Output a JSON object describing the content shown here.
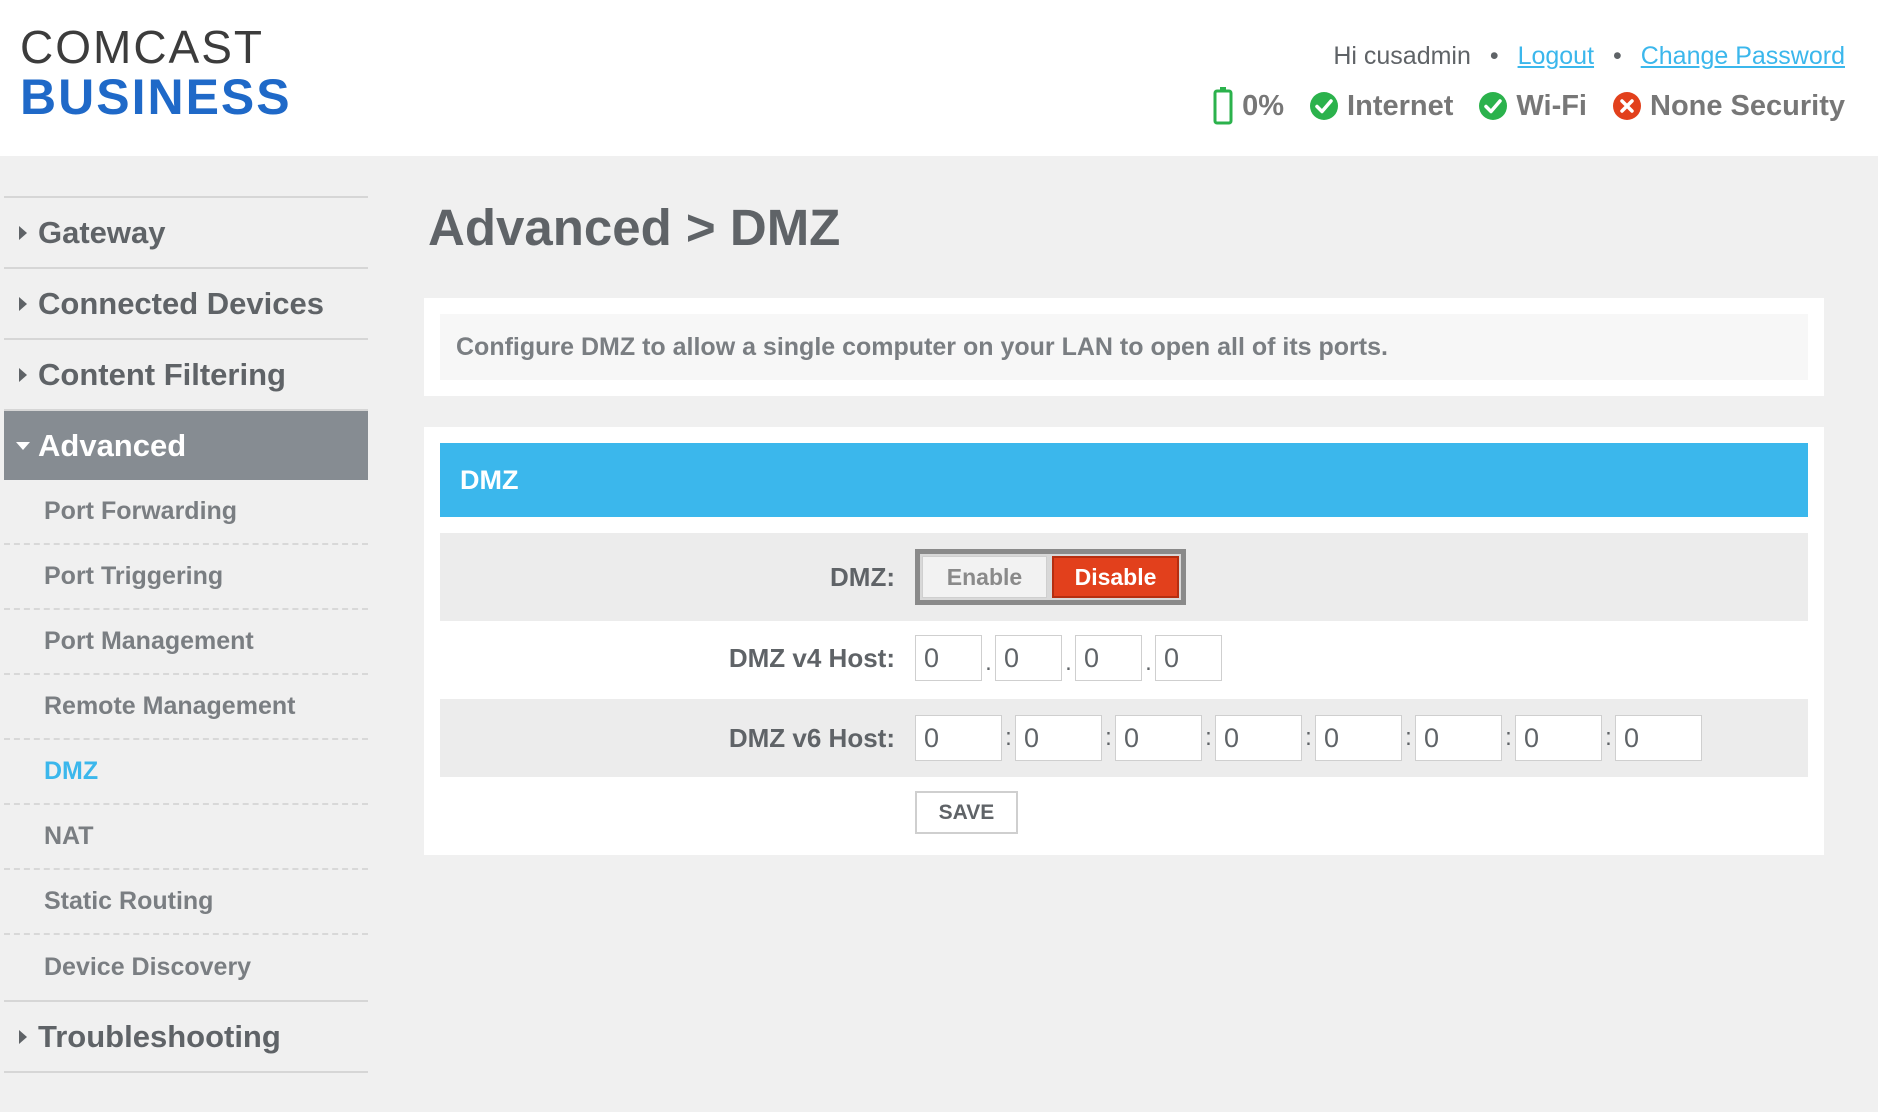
{
  "header": {
    "logo_line1": "COMCAST",
    "logo_line2": "BUSINESS",
    "greeting": "Hi cusadmin",
    "separator": "•",
    "logout": "Logout",
    "change_password": "Change Password",
    "status": [
      {
        "label": "0%",
        "icon": "battery-icon",
        "color": "#2bb24c"
      },
      {
        "label": "Internet",
        "icon": "check-circle-icon",
        "color": "#2bb24c"
      },
      {
        "label": "Wi-Fi",
        "icon": "check-circle-icon",
        "color": "#2bb24c"
      },
      {
        "label": "None Security",
        "icon": "x-circle-icon",
        "color": "#e2401c"
      }
    ]
  },
  "sidebar": {
    "items": [
      {
        "label": "Gateway"
      },
      {
        "label": "Connected Devices"
      },
      {
        "label": "Content Filtering"
      },
      {
        "label": "Advanced"
      },
      {
        "label": "Troubleshooting"
      }
    ],
    "advanced_sub": [
      {
        "label": "Port Forwarding"
      },
      {
        "label": "Port Triggering"
      },
      {
        "label": "Port Management"
      },
      {
        "label": "Remote Management"
      },
      {
        "label": "DMZ"
      },
      {
        "label": "NAT"
      },
      {
        "label": "Static Routing"
      },
      {
        "label": "Device Discovery"
      }
    ]
  },
  "main": {
    "title": "Advanced > DMZ",
    "description": "Configure DMZ to allow a single computer on your LAN to open all of its ports.",
    "panel_title": "DMZ",
    "dmz_label": "DMZ:",
    "enable_label": "Enable",
    "disable_label": "Disable",
    "v4_label": "DMZ v4 Host:",
    "v4_values": [
      "0",
      "0",
      "0",
      "0"
    ],
    "v4_sep": ".",
    "v6_label": "DMZ v6 Host:",
    "v6_values": [
      "0",
      "0",
      "0",
      "0",
      "0",
      "0",
      "0",
      "0"
    ],
    "v6_sep": ":",
    "save_label": "SAVE"
  },
  "colors": {
    "accent": "#3bb7ec",
    "disable_active": "#e2401c",
    "sidebar_active": "#868c92"
  }
}
